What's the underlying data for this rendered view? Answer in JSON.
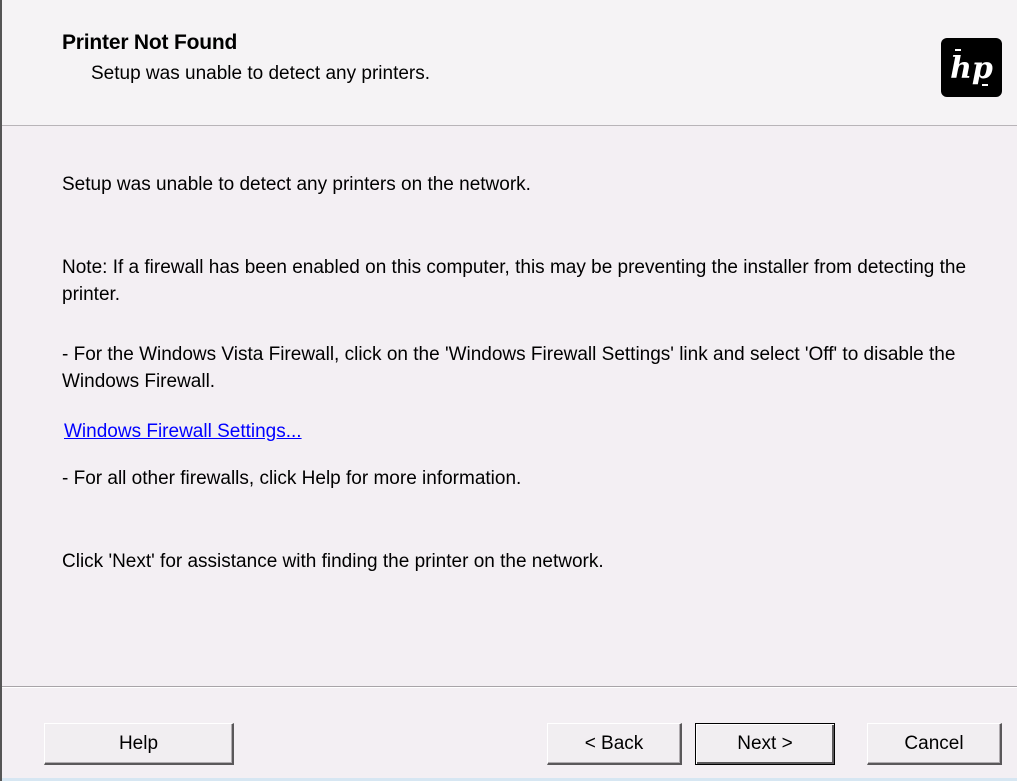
{
  "header": {
    "title": "Printer Not Found",
    "subtitle": "Setup was unable to detect any printers.",
    "logo_text": "hp",
    "logo_icon": "hp-logo-icon"
  },
  "body": {
    "line1": "Setup was unable to detect any printers on the network.",
    "note": "Note: If a firewall has been enabled on this computer, this may be preventing the installer from detecting the printer.",
    "vista_instructions": "- For the Windows Vista Firewall, click on the 'Windows Firewall Settings' link and select 'Off' to disable the Windows Firewall.",
    "firewall_link": "Windows Firewall Settings...",
    "other_firewalls": "- For all other firewalls, click Help for more information.",
    "next_instructions": "Click 'Next' for assistance with finding the printer on the network."
  },
  "buttons": {
    "help": "Help",
    "back": "< Back",
    "next": "Next >",
    "cancel": "Cancel"
  },
  "colors": {
    "background": "#f3eff3",
    "link": "#0000ff",
    "logo_bg": "#000000"
  }
}
